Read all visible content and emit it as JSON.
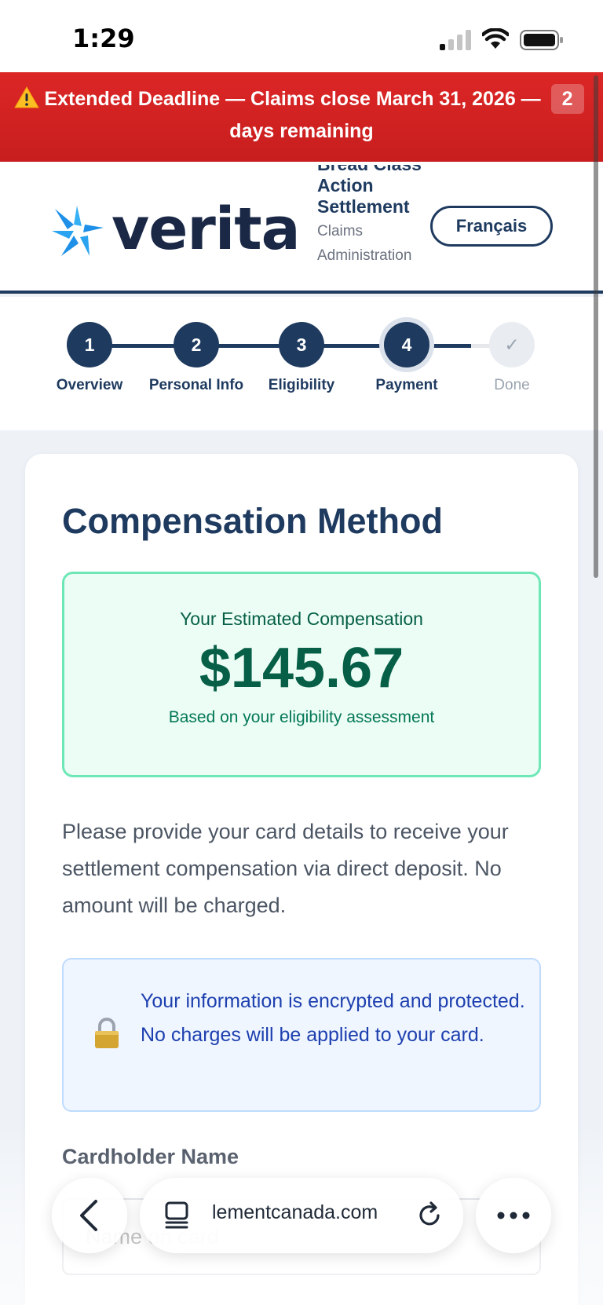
{
  "status_bar": {
    "time": "1:29"
  },
  "banner": {
    "icon": "warning-icon",
    "prefix": "Extended Deadline — Claims close ",
    "date": "March 31, 2026",
    "dash": " — ",
    "days": "2",
    "suffix": " days remaining"
  },
  "header": {
    "logo_text": "verita",
    "org_title": "Bread Class Action Settlement",
    "org_subtitle": "Claims Administration",
    "lang_button": "Français"
  },
  "stepper": {
    "steps": [
      {
        "number": "1",
        "label": "Overview",
        "state": "complete"
      },
      {
        "number": "2",
        "label": "Personal Info",
        "state": "complete"
      },
      {
        "number": "3",
        "label": "Eligibility",
        "state": "complete"
      },
      {
        "number": "4",
        "label": "Payment",
        "state": "current"
      },
      {
        "number": "✓",
        "label": "Done",
        "state": "pending"
      }
    ]
  },
  "main": {
    "title": "Compensation Method",
    "compensation": {
      "label": "Your Estimated Compensation",
      "amount": "$145.67",
      "note": "Based on your eligibility assessment"
    },
    "description": "Please provide your card details to receive your settlement compensation via direct deposit. No amount will be charged.",
    "secure_notice": "Your information is encrypted and protected. No charges will be applied to your card.",
    "cardholder": {
      "label": "Cardholder Name",
      "placeholder": "Name on card"
    }
  },
  "browser": {
    "url": "lementcanada.com"
  },
  "colors": {
    "brand_navy": "#1e3a5f",
    "banner_red": "#dc2626",
    "success_green": "#065f46",
    "info_blue": "#1e40af"
  }
}
